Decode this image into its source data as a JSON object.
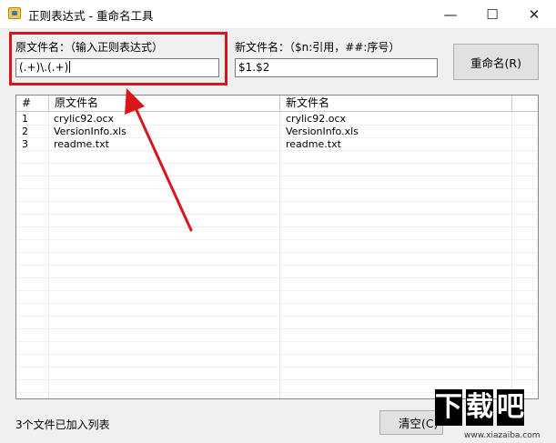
{
  "window": {
    "title": "正则表达式 - 重命名工具",
    "minimize_glyph": "—",
    "maximize_glyph": "☐",
    "close_glyph": "✕"
  },
  "form": {
    "source_label": "原文件名：（输入正则表达式）",
    "source_value": "(.+)\\.(.+)",
    "target_label": "新文件名：（$n:引用，##:序号）",
    "target_value": "$1.$2",
    "rename_button": "重命名(R)"
  },
  "list": {
    "columns": [
      "#",
      "原文件名",
      "新文件名"
    ],
    "rows": [
      {
        "num": "1",
        "old": "crylic92.ocx",
        "new": "crylic92.ocx"
      },
      {
        "num": "2",
        "old": "VersionInfo.xls",
        "new": "VersionInfo.xls"
      },
      {
        "num": "3",
        "old": "readme.txt",
        "new": "readme.txt"
      }
    ]
  },
  "footer": {
    "status": "3个文件已加入列表",
    "clear_button": "清空(C)"
  },
  "watermark": {
    "chars": [
      "下",
      "载",
      "吧"
    ],
    "url": "www.xiazaiba.com"
  },
  "colors": {
    "highlight": "#d9161b",
    "arrow": "#d9161b"
  }
}
